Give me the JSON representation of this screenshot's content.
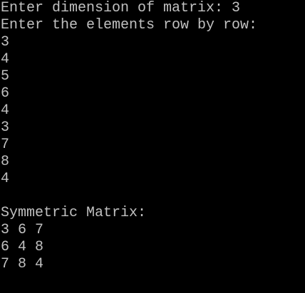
{
  "console": {
    "text_color": "#C0C0C0",
    "background_color": "#000000",
    "prompt_dimension": "Enter dimension of matrix: 3",
    "prompt_elements": "Enter the elements row by row:",
    "inputs": [
      "3",
      "4",
      "5",
      "6",
      "4",
      "3",
      "7",
      "8",
      "4"
    ],
    "result_heading": "Symmetric Matrix:",
    "matrix_rows": [
      "3 6 7",
      "6 4 8",
      "7 8 4"
    ]
  }
}
